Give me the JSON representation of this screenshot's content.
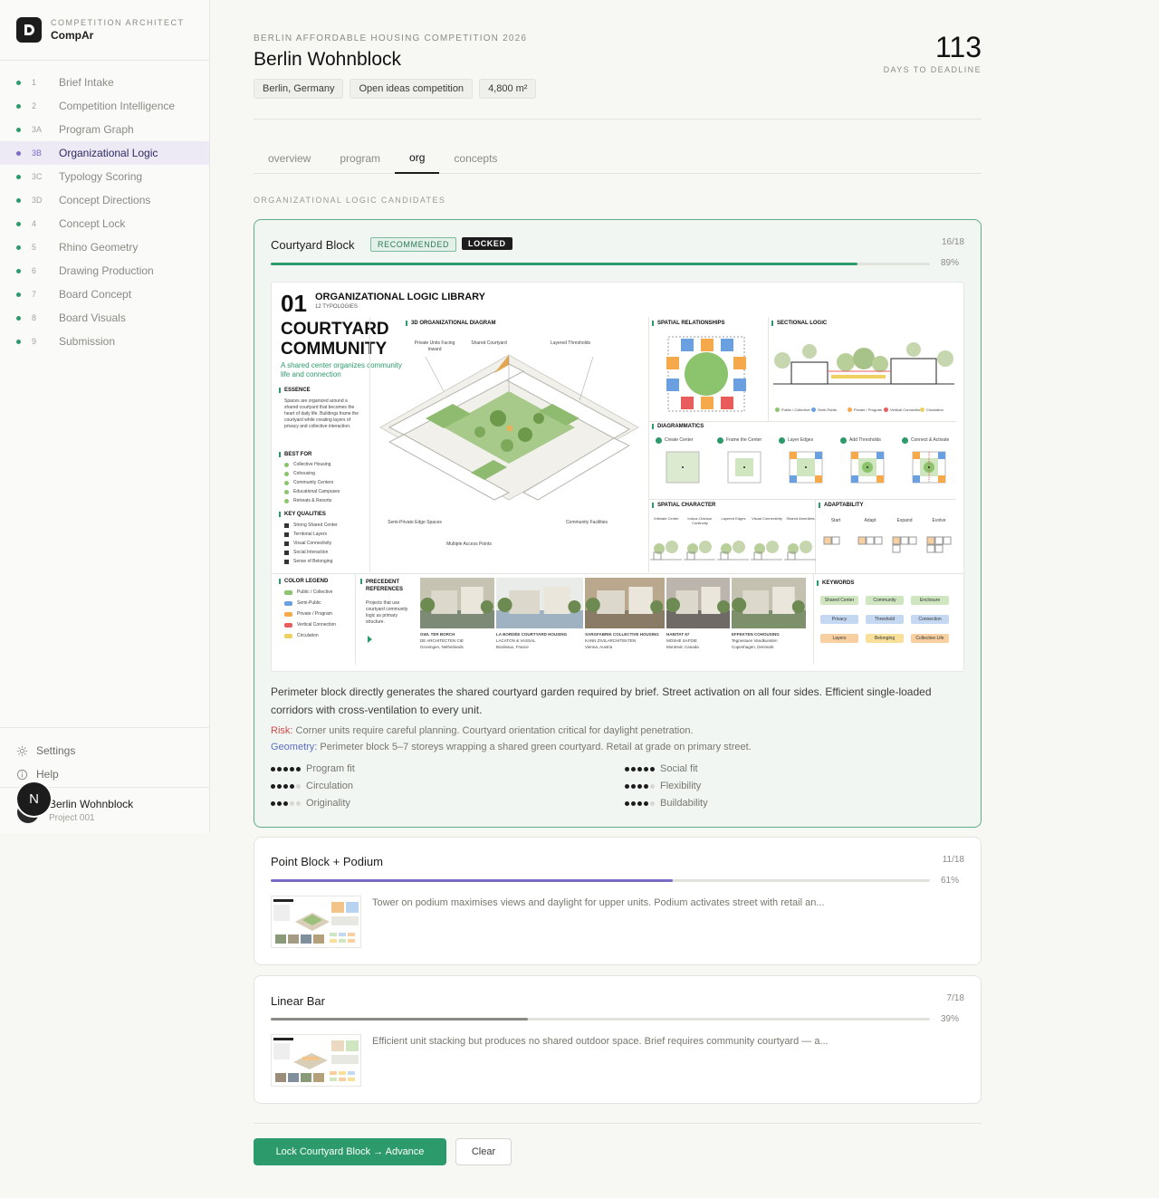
{
  "brand": {
    "subtitle": "COMPETITION ARCHITECT",
    "name": "CompAr"
  },
  "nav": [
    {
      "num": "1",
      "label": "Brief Intake",
      "active": false
    },
    {
      "num": "2",
      "label": "Competition Intelligence",
      "active": false
    },
    {
      "num": "3A",
      "label": "Program Graph",
      "active": false
    },
    {
      "num": "3B",
      "label": "Organizational Logic",
      "active": true
    },
    {
      "num": "3C",
      "label": "Typology Scoring",
      "active": false
    },
    {
      "num": "3D",
      "label": "Concept Directions",
      "active": false
    },
    {
      "num": "4",
      "label": "Concept Lock",
      "active": false
    },
    {
      "num": "5",
      "label": "Rhino Geometry",
      "active": false
    },
    {
      "num": "6",
      "label": "Drawing Production",
      "active": false
    },
    {
      "num": "7",
      "label": "Board Concept",
      "active": false
    },
    {
      "num": "8",
      "label": "Board Visuals",
      "active": false
    },
    {
      "num": "9",
      "label": "Submission",
      "active": false
    }
  ],
  "settings_label": "Settings",
  "help_label": "Help",
  "user": {
    "initial": "N",
    "project_name": "Berlin Wohnblock",
    "project_id": "Project 001"
  },
  "header": {
    "competition": "BERLIN AFFORDABLE HOUSING COMPETITION 2026",
    "title": "Berlin Wohnblock",
    "tags": [
      "Berlin, Germany",
      "Open ideas competition",
      "4,800 m²"
    ],
    "days": "113",
    "days_label": "DAYS TO DEADLINE"
  },
  "tabs": [
    {
      "label": "overview",
      "active": false
    },
    {
      "label": "program",
      "active": false
    },
    {
      "label": "org",
      "active": true
    },
    {
      "label": "concepts",
      "active": false
    }
  ],
  "section_label": "ORGANIZATIONAL LOGIC CANDIDATES",
  "candidates": [
    {
      "name": "Courtyard Block",
      "badges": [
        "RECOMMENDED",
        "LOCKED"
      ],
      "score": "16/18",
      "percent": "89%",
      "fill": 0.89,
      "bar_color": "#2c9a6a",
      "description": "Perimeter block directly generates the shared courtyard garden required by brief. Street activation on all four sides. Efficient single-loaded corridors with cross-ventilation to every unit.",
      "risk_label": "Risk:",
      "risk": "Corner units require careful planning. Courtyard orientation critical for daylight penetration.",
      "geometry_label": "Geometry:",
      "geometry": "Perimeter block 5–7 storeys wrapping a shared green courtyard. Retail at grade on primary street.",
      "metrics": [
        {
          "label": "Program fit",
          "value": 5
        },
        {
          "label": "Social fit",
          "value": 5
        },
        {
          "label": "Circulation",
          "value": 4
        },
        {
          "label": "Flexibility",
          "value": 4
        },
        {
          "label": "Originality",
          "value": 3
        },
        {
          "label": "Buildability",
          "value": 4
        }
      ]
    },
    {
      "name": "Point Block + Podium",
      "score": "11/18",
      "percent": "61%",
      "fill": 0.61,
      "bar_color": "#7b6bc6",
      "description": "Tower on podium maximises views and daylight for upper units. Podium activates street with retail an..."
    },
    {
      "name": "Linear Bar",
      "score": "7/18",
      "percent": "39%",
      "fill": 0.39,
      "bar_color": "#8b8b86",
      "description": "Efficient unit stacking but produces no shared outdoor space. Brief requires community courtyard — a..."
    }
  ],
  "poster": {
    "number": "01",
    "heading": "ORGANIZATIONAL LOGIC LIBRARY",
    "subheading": "12 TYPOLOGIES",
    "title_line1": "COURTYARD",
    "title_line2": "COMMUNITY",
    "tagline": "A shared center organizes community life and connection",
    "essence_title": "ESSENCE",
    "essence_text": "Spaces are organized around a shared courtyard that becomes the heart of daily life. Buildings frame the courtyard while creating layers of privacy and collective interaction.",
    "best_for_title": "BEST FOR",
    "best_for": [
      "Collective Housing",
      "Cohousing",
      "Community Centers",
      "Educational Campuses",
      "Retreats & Resorts"
    ],
    "qualities_title": "KEY QUALITIES",
    "qualities": [
      "Strong Shared Center",
      "Territorial Layers",
      "Visual Connectivity",
      "Social Interaction",
      "Sense of Belonging"
    ],
    "diagram_title": "3D ORGANIZATIONAL DIAGRAM",
    "diagram_labels": [
      "Private Units Facing Inward",
      "Shared Courtyard",
      "Layered Thresholds",
      "Semi-Private Edge Spaces",
      "Multiple Access Points",
      "Community Facilities"
    ],
    "spatial_title": "SPATIAL RELATIONSHIPS",
    "sectional_title": "SECTIONAL LOGIC",
    "section_legend": [
      "Public / Collective",
      "Semi-Public",
      "Private / Program",
      "Vertical Connection",
      "Circulation"
    ],
    "diagrammatics_title": "DIAGRAMMATICS",
    "diagrammatics": [
      "Create Center",
      "Frame the Center",
      "Layer Edges",
      "Add Thresholds",
      "Connect & Activate"
    ],
    "character_title": "SPATIAL CHARACTER",
    "character": [
      "Intimate Center",
      "Indoor-Outdoor Continuity",
      "Layered Edges",
      "Visual Connectivity",
      "Shared Amenities"
    ],
    "adaptability_title": "ADAPTABILITY",
    "adaptability": [
      "Start",
      "Adapt",
      "Expand",
      "Evolve"
    ],
    "legend_title": "COLOR LEGEND",
    "legend": [
      {
        "label": "Public / Collective",
        "color": "#8cc46e"
      },
      {
        "label": "Semi-Public",
        "color": "#6aa0e0"
      },
      {
        "label": "Private / Program",
        "color": "#f5a94a"
      },
      {
        "label": "Vertical Connection",
        "color": "#e85c5c"
      },
      {
        "label": "Circulation",
        "color": "#f0d060"
      }
    ],
    "precedent_title": "PRECEDENT REFERENCES",
    "precedent_text": "Projects that use courtyard community logic as primary structure.",
    "precedents": [
      {
        "name": "GWL TER BORCH",
        "firm": "DE ARCHITECTEN CIE",
        "place": "Groningen, Netherlands"
      },
      {
        "name": "LA BORDÉE COURTYARD HOUSING",
        "firm": "LACATON & VASSAL",
        "place": "Bordeaux, France"
      },
      {
        "name": "SARGFABRIK COLLECTIVE HOUSING",
        "firm": "KANN ZIVILARCHITEKTEN",
        "place": "Vienna, Austria"
      },
      {
        "name": "HABITAT 67",
        "firm": "MOSHE SAFDIE",
        "place": "Montreal, Canada"
      },
      {
        "name": "EFFEKTEN COHOUSING",
        "firm": "Tegnestuen Vandkunsten",
        "place": "Copenhagen, Denmark"
      }
    ],
    "keywords_title": "KEYWORDS",
    "keywords": [
      {
        "label": "Shared Center",
        "color": "#cfe6c0"
      },
      {
        "label": "Community",
        "color": "#cfe6c0"
      },
      {
        "label": "Enclosure",
        "color": "#cfe6c0"
      },
      {
        "label": "Privacy",
        "color": "#c5d8f2"
      },
      {
        "label": "Threshold",
        "color": "#c5d8f2"
      },
      {
        "label": "Connection",
        "color": "#c5d8f2"
      },
      {
        "label": "Layers",
        "color": "#f8cfa0"
      },
      {
        "label": "Belonging",
        "color": "#f8e09a"
      },
      {
        "label": "Collective Life",
        "color": "#f8cfa0"
      }
    ]
  },
  "actions": {
    "primary": "Lock Courtyard Block → Advance",
    "secondary": "Clear"
  },
  "colors": {
    "accent": "#2c9a6a",
    "active_nav": "#7b6bc6",
    "risk": "#cf4b4b",
    "geometry": "#5b6fc5"
  }
}
